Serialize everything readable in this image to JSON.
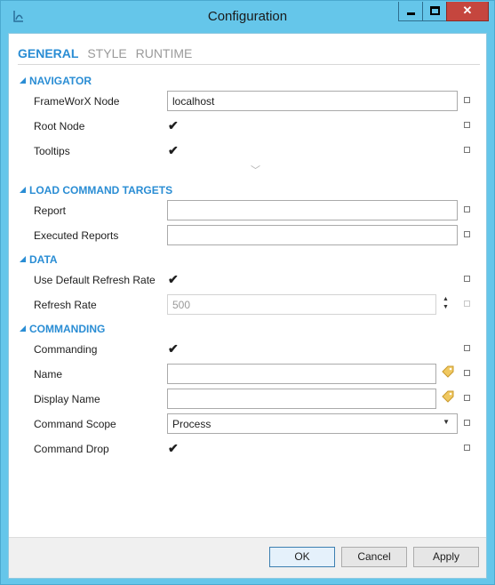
{
  "window": {
    "title": "Configuration",
    "minimize_glyph": "",
    "close_glyph": "✕"
  },
  "tabs": [
    {
      "label": "GENERAL",
      "active": true
    },
    {
      "label": "STYLE",
      "active": false
    },
    {
      "label": "RUNTIME",
      "active": false
    }
  ],
  "sections": {
    "navigator": {
      "title": "NAVIGATOR",
      "framework_node": {
        "label": "FrameWorX Node",
        "value": "localhost"
      },
      "root_node": {
        "label": "Root Node",
        "checked": true
      },
      "tooltips": {
        "label": "Tooltips",
        "checked": true
      },
      "expand_icon": "chevron-down-icon"
    },
    "load_command_targets": {
      "title": "LOAD COMMAND TARGETS",
      "report": {
        "label": "Report",
        "value": ""
      },
      "executed_reports": {
        "label": "Executed Reports",
        "value": ""
      }
    },
    "data": {
      "title": "DATA",
      "use_default_refresh_rate": {
        "label": "Use Default Refresh Rate",
        "checked": true
      },
      "refresh_rate": {
        "label": "Refresh Rate",
        "value": "500",
        "enabled": false
      }
    },
    "commanding": {
      "title": "COMMANDING",
      "commanding": {
        "label": "Commanding",
        "checked": true
      },
      "name": {
        "label": "Name",
        "value": ""
      },
      "display_name": {
        "label": "Display Name",
        "value": ""
      },
      "command_scope": {
        "label": "Command Scope",
        "value": "Process"
      },
      "command_drop": {
        "label": "Command Drop",
        "checked": true
      }
    }
  },
  "check_glyph": "✔",
  "spin_up": "▲",
  "spin_down": "▼",
  "dropdown_glyph": "▼",
  "expand_glyph": "﹀",
  "buttons": {
    "ok": "OK",
    "cancel": "Cancel",
    "apply": "Apply"
  },
  "colors": {
    "accent": "#2a8dd4",
    "titlebar": "#65c6ea",
    "close": "#c5463e"
  }
}
